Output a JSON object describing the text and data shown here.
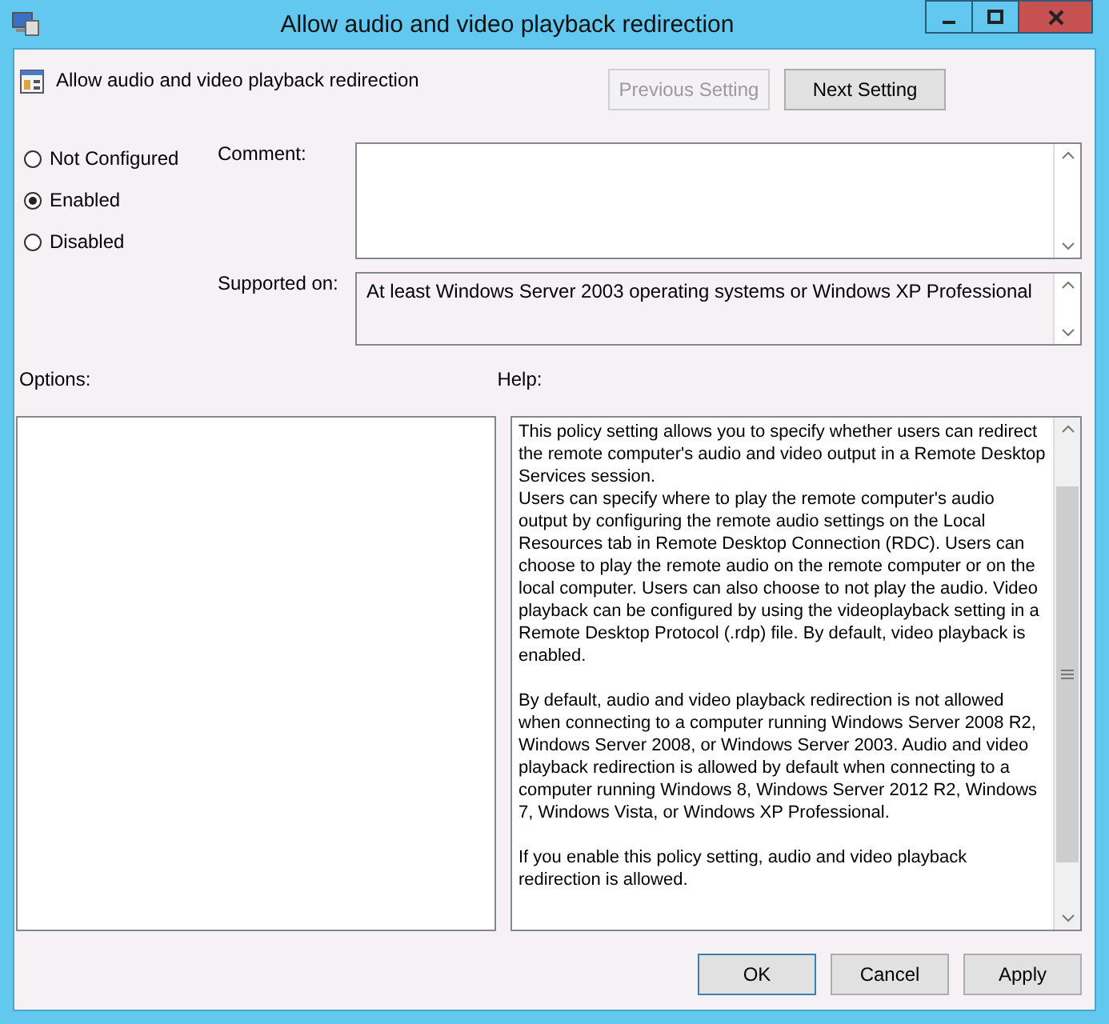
{
  "window": {
    "title": "Allow audio and video playback redirection"
  },
  "setting": {
    "name": "Allow audio and video playback redirection"
  },
  "nav_buttons": [
    {
      "label": "Previous Setting",
      "disabled": true
    },
    {
      "label": "Next Setting",
      "disabled": false
    }
  ],
  "options": [
    {
      "label": "Not Configured",
      "selected": false
    },
    {
      "label": "Enabled",
      "selected": true
    },
    {
      "label": "Disabled",
      "selected": false
    }
  ],
  "comment": {
    "label": "Comment:"
  },
  "supported_on": {
    "label": "Supported on:",
    "value": "At least Windows Server 2003 operating systems or Windows XP Professional"
  },
  "options_label": "Options:",
  "help": {
    "label": "Help:",
    "paragraphs": [
      "This policy setting allows you to specify whether users can redirect the remote computer's audio and video output in a Remote Desktop Services session.\nUsers can specify where to play the remote computer's audio output by configuring the remote audio settings on the Local Resources tab in Remote Desktop Connection (RDC). Users can choose to play the remote audio on the remote computer or on the local computer. Users can also choose to not play the audio. Video playback can be configured by using the videoplayback setting in a Remote Desktop Protocol (.rdp) file. By default, video playback is enabled.",
      "By default, audio and video playback redirection is not allowed when connecting to a computer running Windows Server 2008 R2, Windows Server 2008, or Windows Server 2003. Audio and video playback redirection is allowed by default when connecting to a computer running Windows 8, Windows Server 2012 R2, Windows 7, Windows Vista, or Windows XP Professional.",
      "If you enable this policy setting, audio and video playback redirection is allowed."
    ]
  },
  "buttons": [
    {
      "label": "OK",
      "default": true
    },
    {
      "label": "Cancel",
      "default": false
    },
    {
      "label": "Apply",
      "default": false
    }
  ]
}
